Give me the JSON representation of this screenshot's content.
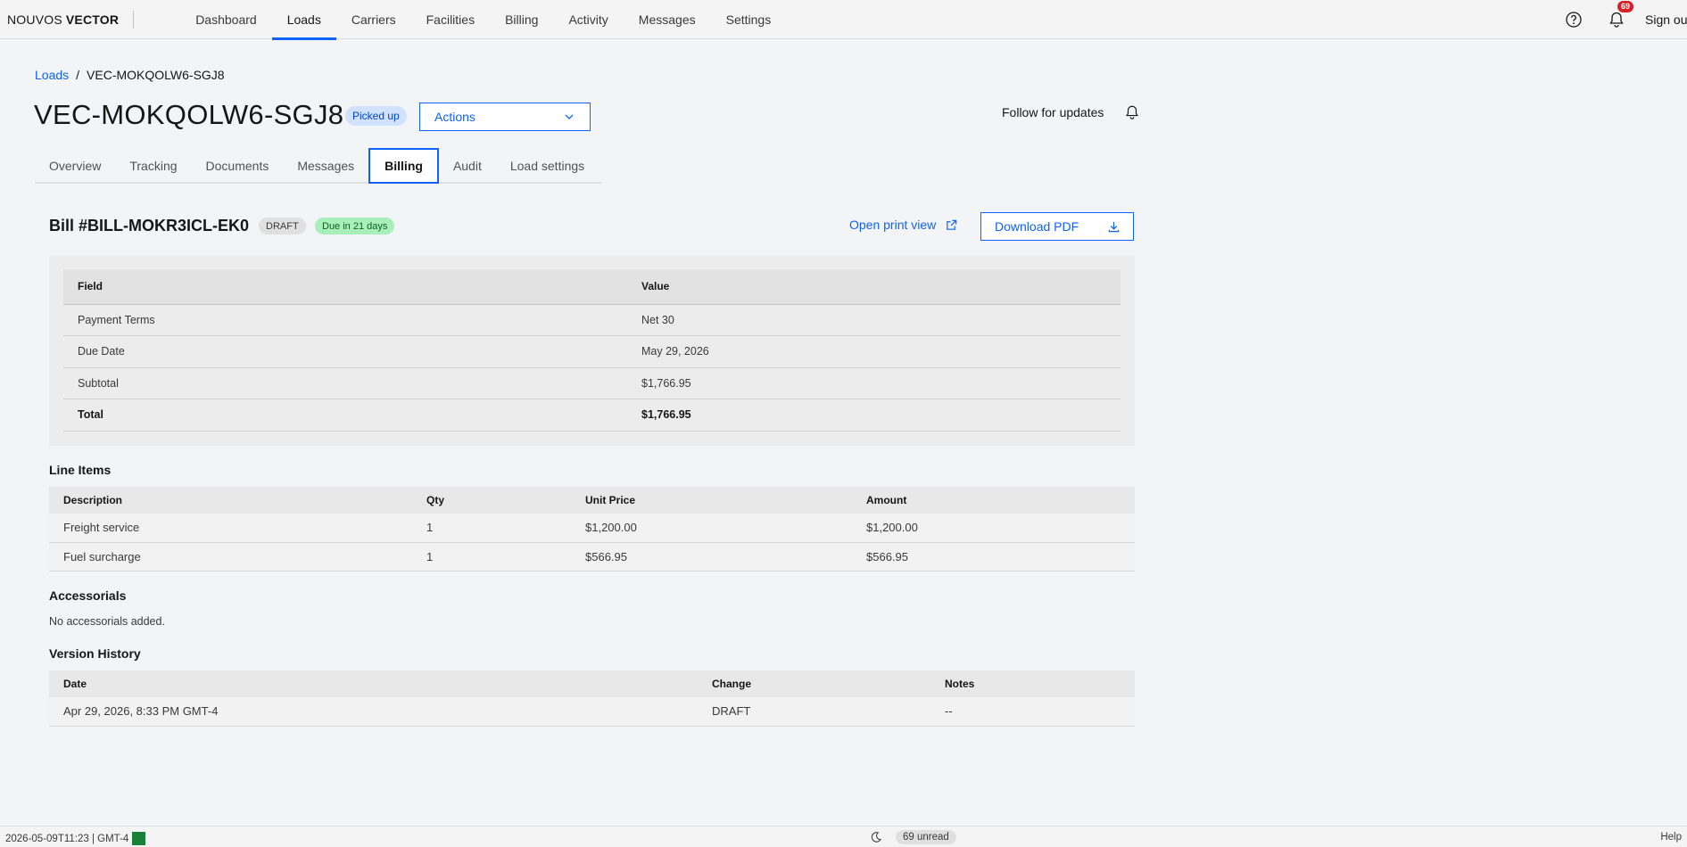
{
  "brand": {
    "part1": "NOUVOS",
    "part2": "VECTOR"
  },
  "nav": {
    "items": [
      {
        "label": "Dashboard",
        "active": false
      },
      {
        "label": "Loads",
        "active": true
      },
      {
        "label": "Carriers",
        "active": false
      },
      {
        "label": "Facilities",
        "active": false
      },
      {
        "label": "Billing",
        "active": false
      },
      {
        "label": "Activity",
        "active": false
      },
      {
        "label": "Messages",
        "active": false
      },
      {
        "label": "Settings",
        "active": false
      }
    ],
    "notification_count": "69",
    "sign_out": "Sign out",
    "icons": {
      "help": "help-icon",
      "notifications": "bell-icon"
    }
  },
  "breadcrumb": {
    "parent": "Loads",
    "separator": "/",
    "current": "VEC-MOKQOLW6-SGJ8"
  },
  "header": {
    "title": "VEC-MOKQOLW6-SGJ8",
    "status": "Picked up",
    "actions_label": "Actions",
    "follow_label": "Follow for updates"
  },
  "tabs": [
    {
      "label": "Overview",
      "active": false
    },
    {
      "label": "Tracking",
      "active": false
    },
    {
      "label": "Documents",
      "active": false
    },
    {
      "label": "Messages",
      "active": false
    },
    {
      "label": "Billing",
      "active": true
    },
    {
      "label": "Audit",
      "active": false
    },
    {
      "label": "Load settings",
      "active": false
    }
  ],
  "bill": {
    "title": "Bill #BILL-MOKR3ICL-EK0",
    "status_tag": "DRAFT",
    "due_tag": "Due in 21 days",
    "print_view_label": "Open print view",
    "download_label": "Download PDF"
  },
  "summary": {
    "headers": {
      "field": "Field",
      "value": "Value"
    },
    "rows": [
      {
        "field": "Payment Terms",
        "value": "Net 30"
      },
      {
        "field": "Due Date",
        "value": "May 29, 2026"
      },
      {
        "field": "Subtotal",
        "value": "$1,766.95"
      },
      {
        "field": "Total",
        "value": "$1,766.95"
      }
    ]
  },
  "line_items": {
    "heading": "Line Items",
    "headers": {
      "description": "Description",
      "qty": "Qty",
      "unit_price": "Unit Price",
      "amount": "Amount"
    },
    "rows": [
      {
        "description": "Freight service",
        "qty": "1",
        "unit_price": "$1,200.00",
        "amount": "$1,200.00"
      },
      {
        "description": "Fuel surcharge",
        "qty": "1",
        "unit_price": "$566.95",
        "amount": "$566.95"
      }
    ]
  },
  "accessorials": {
    "heading": "Accessorials",
    "empty": "No accessorials added."
  },
  "version_history": {
    "heading": "Version History",
    "headers": {
      "date": "Date",
      "change": "Change",
      "notes": "Notes"
    },
    "rows": [
      {
        "date": "Apr 29, 2026, 8:33 PM GMT-4",
        "change": "DRAFT",
        "notes": "--"
      }
    ]
  },
  "footer": {
    "timestamp": "2026-05-09T11:23 | GMT-4",
    "unread": "69 unread",
    "help": "Help"
  },
  "colors": {
    "accent": "#0f62fe",
    "status_green": "#198038",
    "danger": "#da1e28"
  }
}
